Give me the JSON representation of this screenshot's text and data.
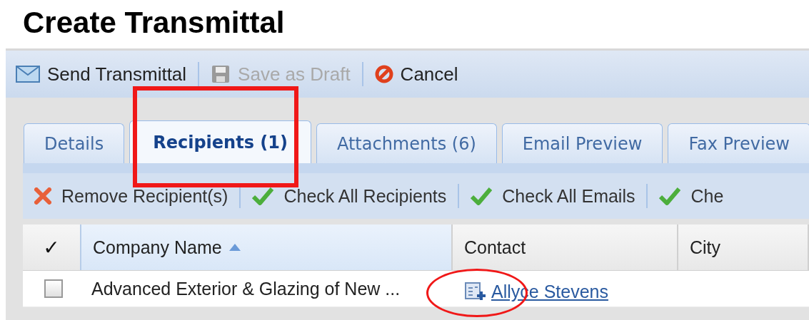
{
  "page": {
    "title": "Create Transmittal"
  },
  "toolbar": [
    {
      "kind": "send",
      "label": "Send Transmittal",
      "disabled": false
    },
    {
      "kind": "save",
      "label": "Save as Draft",
      "disabled": true
    },
    {
      "kind": "cancel",
      "label": "Cancel",
      "disabled": false
    }
  ],
  "tabs": [
    {
      "label": "Details",
      "selected": false
    },
    {
      "label": "Recipients (1)",
      "selected": true
    },
    {
      "label": "Attachments (6)",
      "selected": false
    },
    {
      "label": "Email Preview",
      "selected": false
    },
    {
      "label": "Fax Preview",
      "selected": false
    }
  ],
  "actions": [
    {
      "kind": "remove",
      "label": "Remove Recipient(s)"
    },
    {
      "kind": "check",
      "label": "Check All Recipients"
    },
    {
      "kind": "check",
      "label": "Check All Emails"
    },
    {
      "kind": "check",
      "label": "Che"
    }
  ],
  "table": {
    "check_header": "✓",
    "columns": [
      {
        "label": "Company Name",
        "sorted": true
      },
      {
        "label": "Contact",
        "sorted": false
      },
      {
        "label": "City",
        "sorted": false
      }
    ],
    "rows": [
      {
        "checked": false,
        "company": "Advanced Exterior & Glazing of New ...",
        "contact": "Allyce Stevens"
      }
    ]
  },
  "annotations": [
    {
      "kind": "rectangle"
    },
    {
      "kind": "ellipse"
    }
  ]
}
